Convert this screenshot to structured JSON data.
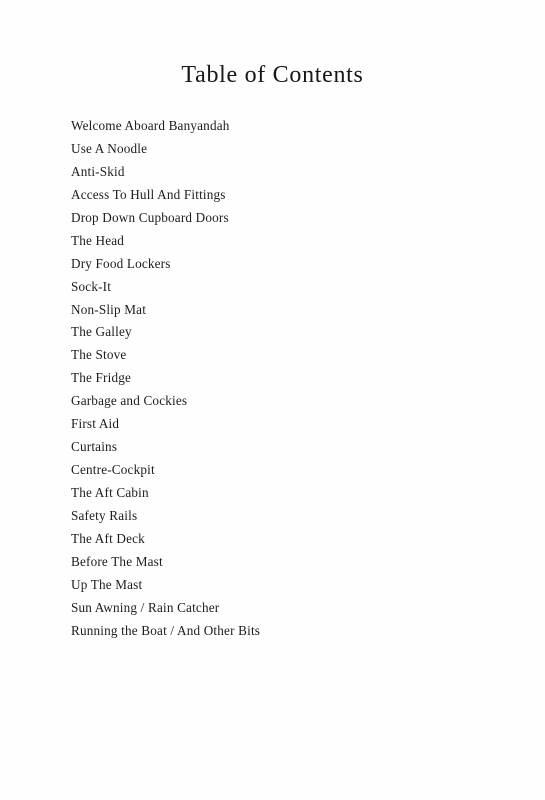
{
  "page": {
    "background_color": "#fffefe",
    "text_color": "#1d1d1d"
  },
  "title": "Table of Contents",
  "contents": {
    "entries": [
      "Welcome Aboard Banyandah",
      "Use A Noodle",
      "Anti-Skid",
      "Access To Hull And Fittings",
      "Drop Down Cupboard Doors",
      "The Head",
      "Dry Food Lockers",
      "Sock-It",
      "Non-Slip Mat",
      "The Galley",
      "The Stove",
      "The Fridge",
      "Garbage and Cockies",
      "First Aid",
      "Curtains",
      "Centre-Cockpit",
      "The Aft Cabin",
      "Safety Rails",
      "The Aft Deck",
      "Before The Mast",
      "Up The Mast",
      "Sun Awning / Rain Catcher",
      "Running the Boat / And Other Bits"
    ]
  }
}
